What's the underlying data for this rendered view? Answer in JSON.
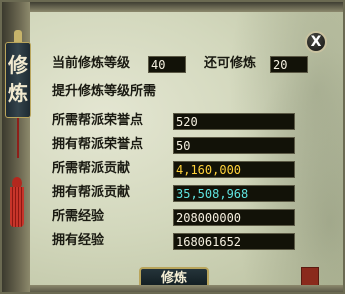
{
  "panel": {
    "title_chars": [
      "修",
      "炼"
    ],
    "close_label": "X"
  },
  "header": {
    "current_level_label": "当前修炼等级",
    "current_level_value": "40",
    "max_level_label": "还可修炼",
    "max_level_value": "20",
    "requirements_label": "提升修炼等级所需"
  },
  "stats": [
    {
      "label": "所需帮派荣誉点",
      "value": "520",
      "color": "white"
    },
    {
      "label": "拥有帮派荣誉点",
      "value": "50",
      "color": "white"
    },
    {
      "label": "所需帮派贡献",
      "value": "4,160,000",
      "color": "yellow"
    },
    {
      "label": "拥有帮派贡献",
      "value": "35,508,968",
      "color": "cyan"
    },
    {
      "label": "所需经验",
      "value": "208000000",
      "color": "white"
    },
    {
      "label": "拥有经验",
      "value": "168061652",
      "color": "white"
    }
  ],
  "actions": {
    "cultivate_label": "修炼"
  },
  "colors": {
    "yellow_value": "#ffd23a",
    "cyan_value": "#5fe3e0",
    "panel_bg": "#d3d8bd",
    "field_bg": "#121208"
  }
}
